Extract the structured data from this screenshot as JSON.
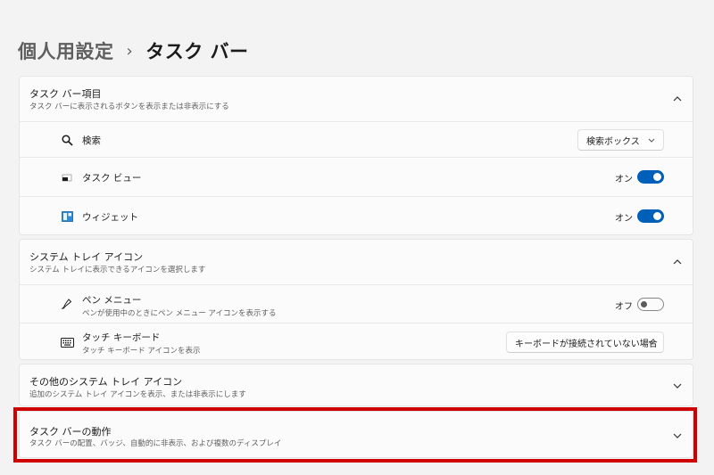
{
  "breadcrumb": {
    "parent": "個人用設定",
    "separator": "›",
    "current": "タスク バー"
  },
  "taskbar_items": {
    "title": "タスク バー項目",
    "subtitle": "タスク バーに表示されるボタンを表示または非表示にする",
    "rows": [
      {
        "label": "検索",
        "icon": "search-icon",
        "control": "dropdown",
        "value": "検索ボックス"
      },
      {
        "label": "タスク ビュー",
        "icon": "task-view-icon",
        "control": "toggle",
        "state_text": "オン",
        "on": true
      },
      {
        "label": "ウィジェット",
        "icon": "widgets-icon",
        "control": "toggle",
        "state_text": "オン",
        "on": true
      }
    ]
  },
  "system_tray": {
    "title": "システム トレイ アイコン",
    "subtitle": "システム トレイに表示できるアイコンを選択します",
    "rows": [
      {
        "label": "ペン メニュー",
        "sub": "ペンが使用中のときにペン メニュー アイコンを表示する",
        "icon": "pen-icon",
        "control": "toggle",
        "state_text": "オフ",
        "on": false
      },
      {
        "label": "タッチ キーボード",
        "sub": "タッチ キーボード アイコンを表示",
        "icon": "keyboard-icon",
        "control": "dropdown",
        "value": "キーボードが接続されていない場合"
      }
    ]
  },
  "other_tray": {
    "title": "その他のシステム トレイ アイコン",
    "subtitle": "追加のシステム トレイ アイコンを表示、または非表示にします"
  },
  "behaviors": {
    "title": "タスク バーの動作",
    "subtitle": "タスク バーの配置、バッジ、自動的に非表示、および複数のディスプレイ"
  },
  "colors": {
    "accent": "#005fb8",
    "highlight": "#d10000",
    "background": "#f3f3f3",
    "card": "#fbfbfb"
  }
}
